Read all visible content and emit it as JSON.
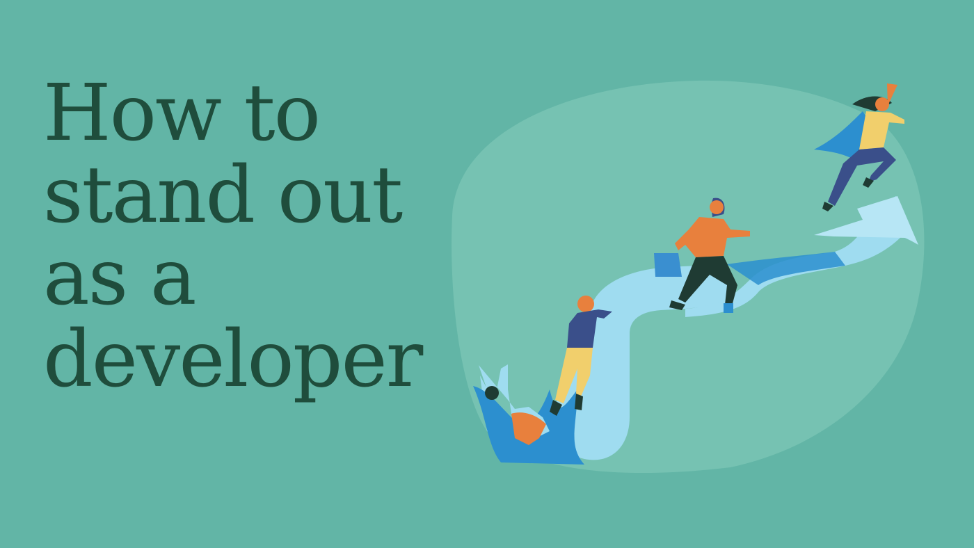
{
  "banner": {
    "title_lines": [
      "How to",
      "stand out",
      "as a",
      "developer"
    ],
    "colors": {
      "background": "#62b5a6",
      "blob": "#76c2b2",
      "title": "#1f4d3c",
      "ribbon_light": "#9fdcf0",
      "ribbon_dark": "#2c8fcf",
      "orange": "#e8803d",
      "navy": "#3a4f8a",
      "yellow": "#f1cf6c",
      "dark_green": "#1f3b33"
    }
  },
  "illustration": {
    "figures": [
      "person-falling",
      "person-climbing",
      "person-walking-with-briefcase",
      "person-flying-with-cape"
    ],
    "icons": [
      "up-arrow-icon",
      "briefcase-icon",
      "cape-icon"
    ]
  }
}
